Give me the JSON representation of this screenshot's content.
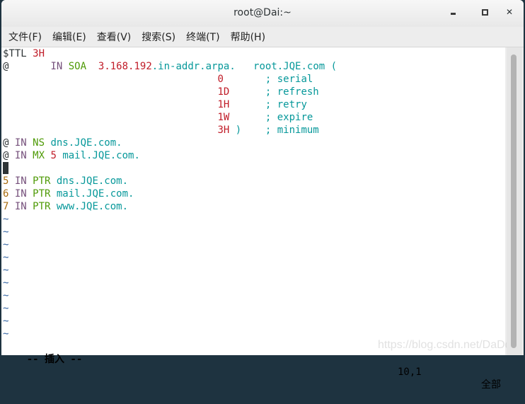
{
  "window": {
    "title": "root@Dai:~",
    "controls": {
      "minimize": "minimize",
      "maximize": "maximize",
      "close": "✕"
    }
  },
  "menu": [
    "文件(F)",
    "编辑(E)",
    "查看(V)",
    "搜索(S)",
    "终端(T)",
    "帮助(H)"
  ],
  "editor": {
    "lines": [
      [
        {
          "t": "$TTL ",
          "c": "plain"
        },
        {
          "t": "3H",
          "c": "red"
        }
      ],
      [
        {
          "t": "@       ",
          "c": "plain"
        },
        {
          "t": "IN ",
          "c": "purple"
        },
        {
          "t": "SOA",
          "c": "green"
        },
        {
          "t": "  ",
          "c": "plain"
        },
        {
          "t": "3.168.192",
          "c": "red"
        },
        {
          "t": ".in-addr.arpa.   root.JQE.com (",
          "c": "teal"
        }
      ],
      [
        {
          "t": "                                    ",
          "c": "plain"
        },
        {
          "t": "0",
          "c": "red"
        },
        {
          "t": "       ; serial",
          "c": "teal"
        }
      ],
      [
        {
          "t": "                                    ",
          "c": "plain"
        },
        {
          "t": "1D",
          "c": "red"
        },
        {
          "t": "      ; refresh",
          "c": "teal"
        }
      ],
      [
        {
          "t": "                                    ",
          "c": "plain"
        },
        {
          "t": "1H",
          "c": "red"
        },
        {
          "t": "      ; retry",
          "c": "teal"
        }
      ],
      [
        {
          "t": "                                    ",
          "c": "plain"
        },
        {
          "t": "1W",
          "c": "red"
        },
        {
          "t": "      ; expire",
          "c": "teal"
        }
      ],
      [
        {
          "t": "                                    ",
          "c": "plain"
        },
        {
          "t": "3H",
          "c": "red"
        },
        {
          "t": " )    ; minimum",
          "c": "teal"
        }
      ],
      [
        {
          "t": "@ ",
          "c": "plain"
        },
        {
          "t": "IN ",
          "c": "purple"
        },
        {
          "t": "NS ",
          "c": "green"
        },
        {
          "t": "dns.JQE.com.",
          "c": "teal"
        }
      ],
      [
        {
          "t": "@ ",
          "c": "plain"
        },
        {
          "t": "IN ",
          "c": "purple"
        },
        {
          "t": "MX ",
          "c": "green"
        },
        {
          "t": "5 ",
          "c": "red"
        },
        {
          "t": "mail.JQE.com.",
          "c": "teal"
        }
      ],
      [
        {
          "t": "",
          "c": "cursor"
        }
      ],
      [
        {
          "t": "5 ",
          "c": "orange"
        },
        {
          "t": "IN ",
          "c": "purple"
        },
        {
          "t": "PTR ",
          "c": "green"
        },
        {
          "t": "dns.JQE.com.",
          "c": "teal"
        }
      ],
      [
        {
          "t": "6 ",
          "c": "orange"
        },
        {
          "t": "IN ",
          "c": "purple"
        },
        {
          "t": "PTR ",
          "c": "green"
        },
        {
          "t": "mail.JQE.com.",
          "c": "teal"
        }
      ],
      [
        {
          "t": "7 ",
          "c": "orange"
        },
        {
          "t": "IN ",
          "c": "purple"
        },
        {
          "t": "PTR ",
          "c": "green"
        },
        {
          "t": "www.JQE.com.",
          "c": "teal"
        }
      ]
    ],
    "empty_line_marker": "~",
    "empty_line_count": 10
  },
  "status": {
    "mode": "-- 插入 --",
    "position": "10,1",
    "scroll": "全部"
  },
  "watermark": "https://blog.csdn.net/DaDdai"
}
